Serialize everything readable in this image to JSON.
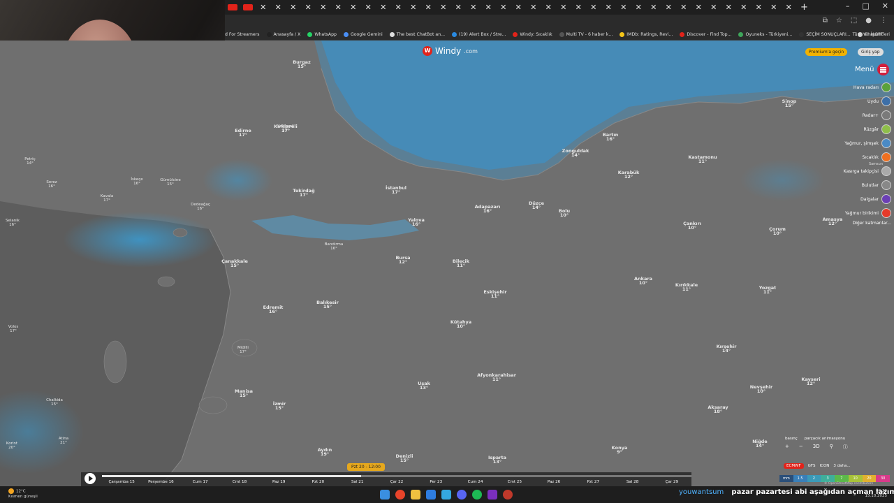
{
  "browser": {
    "tab_count": 38,
    "new_tab": "+",
    "window_controls": [
      "–",
      "□",
      "✕"
    ],
    "bookmarks": [
      {
        "label": "d For Streamers",
        "color": ""
      },
      {
        "label": "Anasayfa / X",
        "color": "#222"
      },
      {
        "label": "WhatsApp",
        "color": "#25d366"
      },
      {
        "label": "Google Gemini",
        "color": "#4a8ff5"
      },
      {
        "label": "The best ChatBot an...",
        "color": "#ddd"
      },
      {
        "label": "(19) Alert Box / Stre...",
        "color": "#2a8ae0"
      },
      {
        "label": "Windy: Sıcaklık",
        "color": "#e2231a"
      },
      {
        "label": "Multi TV - 6 haber k...",
        "color": "#555"
      },
      {
        "label": "IMDb: Ratings, Revi...",
        "color": "#f5c518"
      },
      {
        "label": "Discover - Find Top...",
        "color": "#e2231a"
      },
      {
        "label": "Oyuneks - Türkiyeni...",
        "color": "#3ea55a"
      },
      {
        "label": "SEÇİM SONUÇLARI...",
        "color": "#333"
      },
      {
        "label": "ChatGPT",
        "color": "#ccc"
      }
    ],
    "all_bookmarks": "Tüm Yer İşaretleri"
  },
  "windy": {
    "logo_text": "Windy",
    "logo_suffix": ".com",
    "premium_button": "Premium'a geçin",
    "login_button": "Giriş yap",
    "menu_label": "Menü",
    "layers": [
      {
        "label": "Hava radarı",
        "color": "#5aa23a"
      },
      {
        "label": "Uydu",
        "color": "#3d6fa8"
      },
      {
        "label": "Radar+",
        "color": "#7a7a7a"
      },
      {
        "label": "Rüzgâr",
        "color": "#8fbf4a"
      },
      {
        "label": "Yağmur, şimşek",
        "color": "#4a8ac5"
      },
      {
        "label": "Sıcaklık",
        "color": "#f07020"
      },
      {
        "label": "Kasırga takipçisi",
        "color": "#aaa"
      },
      {
        "label": "Bulutlar",
        "color": "#888"
      },
      {
        "label": "Dalgalar",
        "color": "#6b3fb5"
      },
      {
        "label": "Yağmur birikimi",
        "color": "#e53a2a"
      },
      {
        "label": "Diğer katmanlar...",
        "color": ""
      }
    ],
    "layer_sub": "Samsun",
    "controls": {
      "toggle_row": [
        "basınç",
        "parçacık animasyonu"
      ],
      "zoom_row": [
        "+",
        "−",
        "3D",
        "⚲",
        "ⓘ"
      ],
      "models": [
        "ECMWF",
        "GFS",
        "ICON",
        "3 daha..."
      ],
      "units": "mm",
      "scale": [
        "1.5",
        "2",
        "3",
        "7",
        "10",
        "20",
        "30"
      ],
      "attribution": "© OpenStreetMap contributors"
    }
  },
  "cities": [
    {
      "name": "Burgaz",
      "temp": "15°"
    },
    {
      "name": "Edirne",
      "temp": "17°"
    },
    {
      "name": "Kırklareli",
      "temp": "17°"
    },
    {
      "name": "Tekirdağ",
      "temp": "17°"
    },
    {
      "name": "İstanbul",
      "temp": "17°"
    },
    {
      "name": "Zonguldak",
      "temp": "14°"
    },
    {
      "name": "Bartın",
      "temp": "16°"
    },
    {
      "name": "Sinop",
      "temp": "15°"
    },
    {
      "name": "Kastamonu",
      "temp": "11°"
    },
    {
      "name": "Karabük",
      "temp": "12°"
    },
    {
      "name": "Düzce",
      "temp": "14°"
    },
    {
      "name": "Bolu",
      "temp": "10°"
    },
    {
      "name": "Adapazarı",
      "temp": "16°"
    },
    {
      "name": "Yalova",
      "temp": "16°"
    },
    {
      "name": "Bursa",
      "temp": "12°"
    },
    {
      "name": "Bilecik",
      "temp": "11°"
    },
    {
      "name": "Çankırı",
      "temp": "10°"
    },
    {
      "name": "Çorum",
      "temp": "10°"
    },
    {
      "name": "Amasya",
      "temp": "12°"
    },
    {
      "name": "Ankara",
      "temp": "10°"
    },
    {
      "name": "Kırıkkale",
      "temp": "11°"
    },
    {
      "name": "Yozgat",
      "temp": "11°"
    },
    {
      "name": "Eskişehir",
      "temp": "11°"
    },
    {
      "name": "Kütahya",
      "temp": "10°"
    },
    {
      "name": "Balıkesir",
      "temp": "15°"
    },
    {
      "name": "Çanakkale",
      "temp": "15°"
    },
    {
      "name": "Edremit",
      "temp": "16°"
    },
    {
      "name": "Manisa",
      "temp": "15°"
    },
    {
      "name": "İzmir",
      "temp": "15°"
    },
    {
      "name": "Uşak",
      "temp": "13°"
    },
    {
      "name": "Afyonkarahisar",
      "temp": "11°"
    },
    {
      "name": "Aydın",
      "temp": "19°"
    },
    {
      "name": "Denizli",
      "temp": "15°"
    },
    {
      "name": "Isparta",
      "temp": "13°"
    },
    {
      "name": "Konya",
      "temp": "9°"
    },
    {
      "name": "Aksaray",
      "temp": "18°"
    },
    {
      "name": "Kırşehir",
      "temp": "14°"
    },
    {
      "name": "Nevşehir",
      "temp": "10°"
    },
    {
      "name": "Kayseri",
      "temp": "12°"
    },
    {
      "name": "Niğde",
      "temp": "14°"
    },
    {
      "name": "Dedeağaç",
      "temp": "16°"
    },
    {
      "name": "Kavala",
      "temp": "17°"
    },
    {
      "name": "Serez",
      "temp": "16°"
    },
    {
      "name": "Petriç",
      "temp": "14°"
    },
    {
      "name": "Selanik",
      "temp": "16°"
    },
    {
      "name": "Midilli",
      "temp": "17°"
    },
    {
      "name": "Chalkida",
      "temp": "15°"
    },
    {
      "name": "Atina",
      "temp": "21°"
    },
    {
      "name": "Volos",
      "temp": "17°"
    },
    {
      "name": "Korint",
      "temp": "20°"
    },
    {
      "name": "Gümülcine",
      "temp": "15°"
    },
    {
      "name": "İskeçe",
      "temp": "16°"
    },
    {
      "name": "Bandırma",
      "temp": "16°"
    },
    {
      "name": "Kırklareli",
      "temp": "17°"
    }
  ],
  "timeline": {
    "play": "▶",
    "current": "Pzt 20 - 12:00",
    "progress": 0.44,
    "days": [
      "Çarşamba 15",
      "Perşembe 16",
      "Cum 17",
      "Cmt 18",
      "Paz 19",
      "Pzt 20",
      "Sal 21",
      "Çar 22",
      "Per 23",
      "Cum 24",
      "Cmt 25",
      "Paz 26",
      "Pzt 27",
      "Sal 28",
      "Çar 29"
    ]
  },
  "taskbar": {
    "temp": "12°C",
    "weather": "Kısmen güneşli",
    "chat_user": "youwantsum",
    "chat_message": "pazar pazartesi abi aşağıdan açman lazım",
    "time": "08:39",
    "date": "15.10.2025"
  }
}
